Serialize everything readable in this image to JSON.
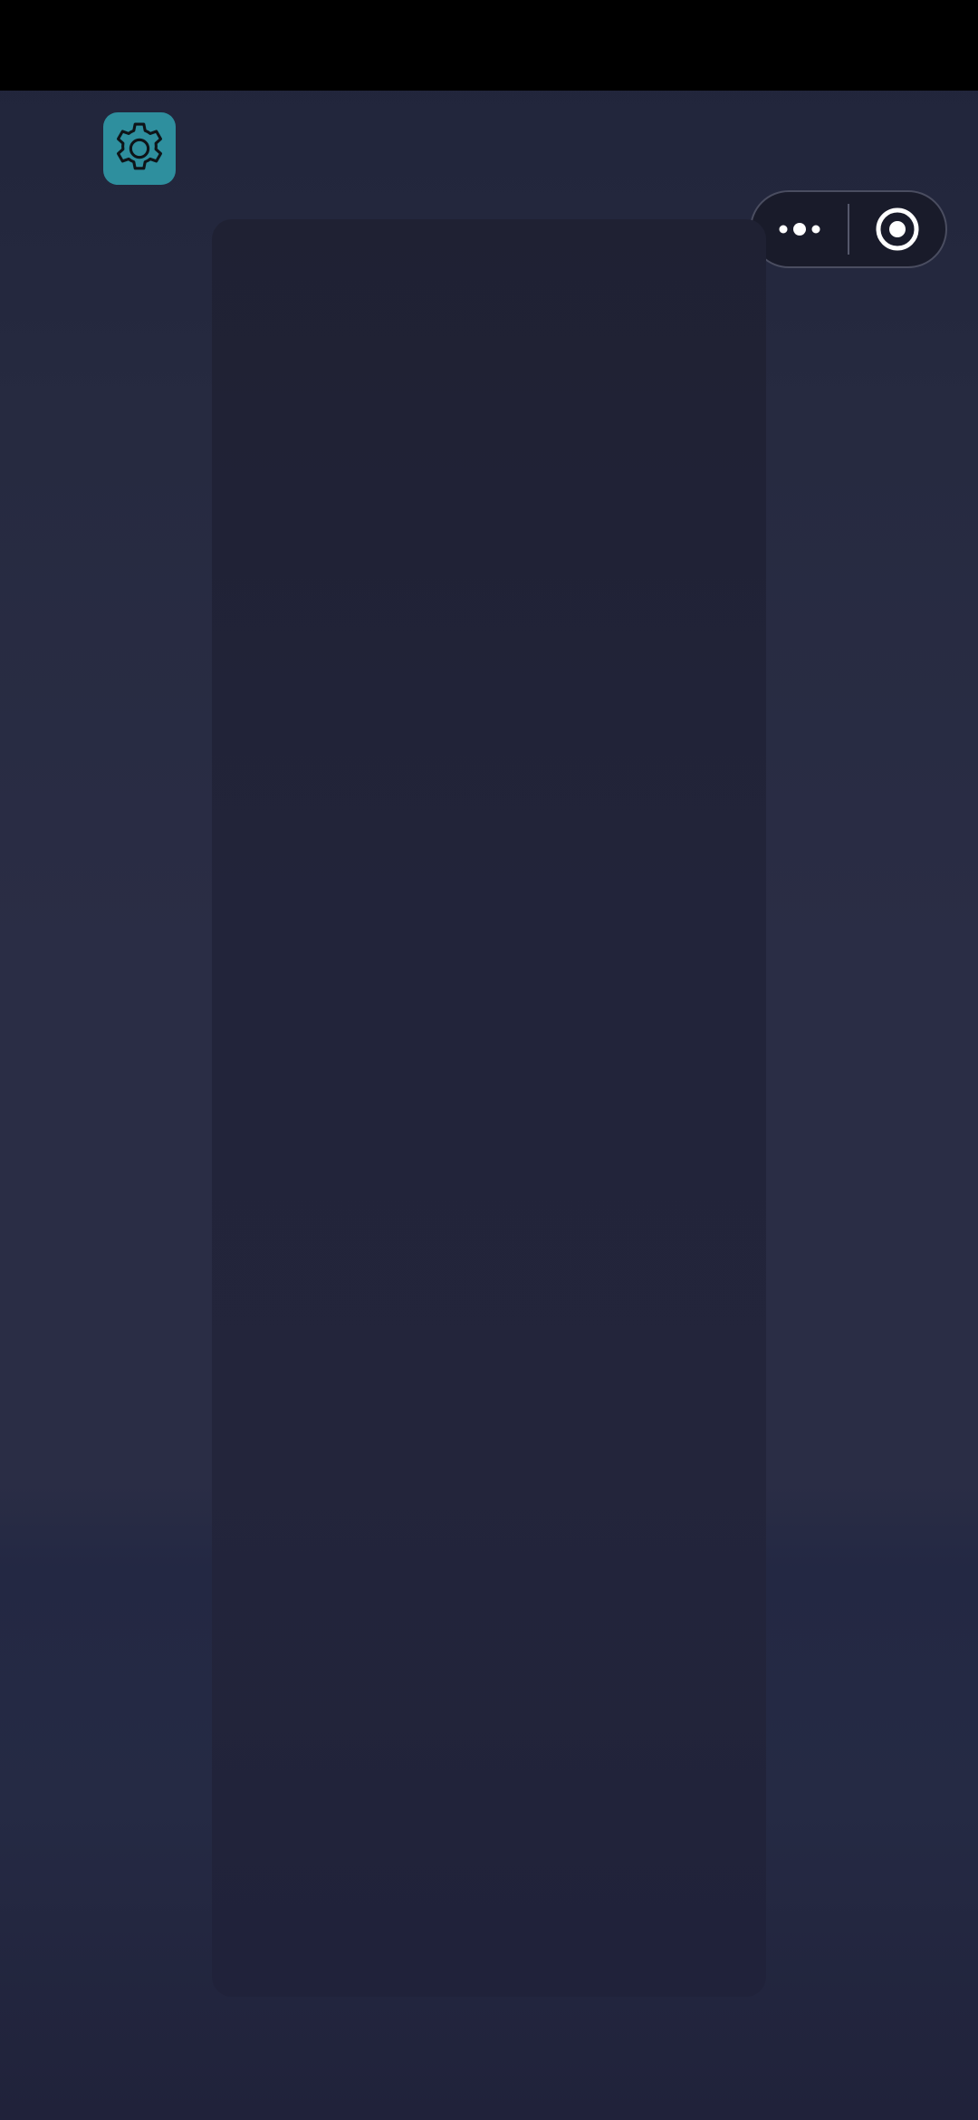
{
  "status_bar": {
    "color": "#000000"
  },
  "toolbar": {
    "settings_icon": "gear-icon",
    "settings_color": "#2e8f9e"
  },
  "capsule": {
    "more_icon": "more-dots-icon",
    "close_icon": "target-close-icon"
  },
  "content_panel": {
    "color": "#22243a"
  }
}
